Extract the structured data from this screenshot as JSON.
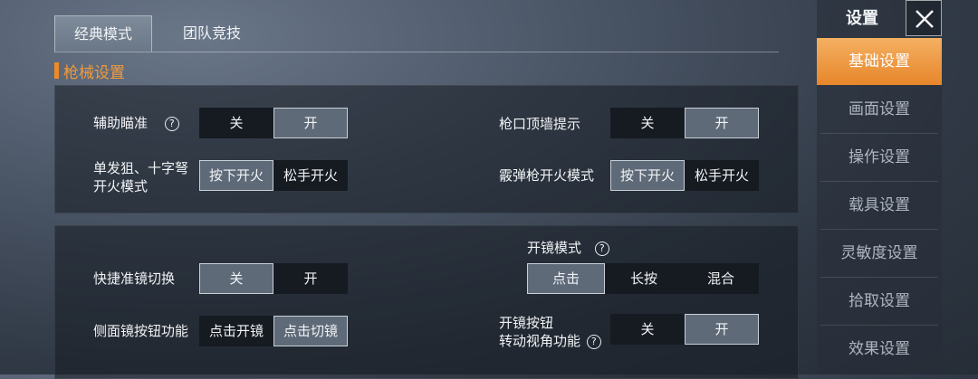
{
  "tabs": [
    {
      "label": "经典模式",
      "active": true
    },
    {
      "label": "团队竞技",
      "active": false
    }
  ],
  "section_title": "枪械设置",
  "panel1": {
    "aim_assist": {
      "label": "辅助瞄准",
      "help": "?",
      "options": [
        "关",
        "开"
      ],
      "selected": 1
    },
    "wall_hint": {
      "label": "枪口顶墙提示",
      "options": [
        "关",
        "开"
      ],
      "selected": 1
    },
    "sniper_fire": {
      "label_line1": "单发狙、十字弩",
      "label_line2": "开火模式",
      "options": [
        "按下开火",
        "松手开火"
      ],
      "selected": 0
    },
    "shotgun_fire": {
      "label": "霰弹枪开火模式",
      "options": [
        "按下开火",
        "松手开火"
      ],
      "selected": 0
    }
  },
  "panel2": {
    "scope_mode": {
      "label": "开镜模式",
      "help": "?",
      "options": [
        "点击",
        "长按",
        "混合"
      ],
      "selected": 0
    },
    "quick_scope": {
      "label": "快捷准镜切换",
      "options": [
        "关",
        "开"
      ],
      "selected": 0
    },
    "side_scope": {
      "label": "侧面镜按钮功能",
      "options": [
        "点击开镜",
        "点击切镜"
      ],
      "selected": 1
    },
    "scope_rotate": {
      "label_line1": "开镜按钮",
      "label_line2": "转动视角功能",
      "help": "?",
      "options": [
        "关",
        "开"
      ],
      "selected": 1
    }
  },
  "sidebar": {
    "title": "设置",
    "close_icon": "close-icon",
    "items": [
      {
        "label": "基础设置",
        "active": true
      },
      {
        "label": "画面设置",
        "active": false
      },
      {
        "label": "操作设置",
        "active": false
      },
      {
        "label": "载具设置",
        "active": false
      },
      {
        "label": "灵敏度设置",
        "active": false
      },
      {
        "label": "拾取设置",
        "active": false
      },
      {
        "label": "效果设置",
        "active": false
      }
    ]
  },
  "colors": {
    "accent_orange": "#f08a24",
    "selected_button": "#5e6a78",
    "unselected_button": "#161b22"
  }
}
